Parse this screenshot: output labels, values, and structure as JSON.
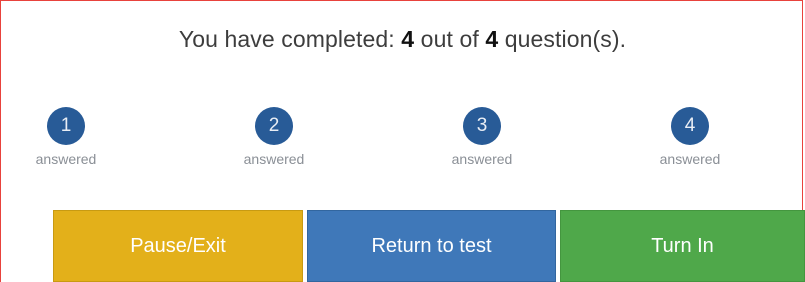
{
  "summary": {
    "prefix": "You have completed: ",
    "completed": "4",
    "middle": " out of ",
    "total": "4",
    "suffix": " question(s)."
  },
  "questions": [
    {
      "number": "1",
      "status": "answered"
    },
    {
      "number": "2",
      "status": "answered"
    },
    {
      "number": "3",
      "status": "answered"
    },
    {
      "number": "4",
      "status": "answered"
    }
  ],
  "buttons": {
    "pause": "Pause/Exit",
    "return": "Return to test",
    "turn_in": "Turn In"
  },
  "colors": {
    "question_circle": "#285b97",
    "pause": "#e3b01a",
    "return": "#3f78b9",
    "turn_in": "#4fa84a",
    "frame": "#e8423c"
  }
}
